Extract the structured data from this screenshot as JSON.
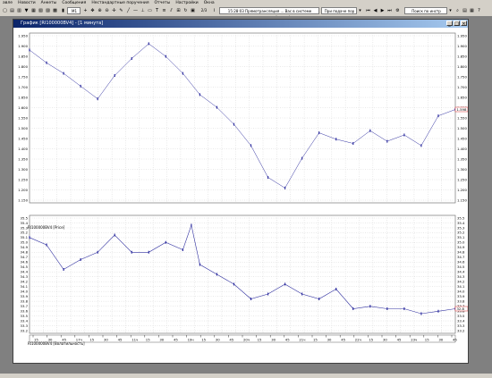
{
  "menu": [
    "авле",
    "Новости",
    "Анкеты",
    "Сообщения",
    "Нестандартные поручения",
    "Отчеты",
    "Настройки",
    "Окна"
  ],
  "toolbar": {
    "quantity": "М1",
    "zoom": "2/3",
    "news_ticker": "15:28:03  Прямотрансляция ... Вас в системе интернет-трейдинга!",
    "news_dropdown": "При подаче пор",
    "search_placeholder": "Поиск по инстр"
  },
  "window": {
    "title": "График [RI100000BV4] - [1 минута]",
    "price_label": "RI100000BV4 [Price]",
    "vol_label": "RI100000BV4 [Волатильность]",
    "price_marker": "1.598",
    "vol_marker": "32.8"
  },
  "colors": {
    "series": "#3030a0",
    "titlebar": "#0a246a",
    "grid": "#c8c8c8"
  },
  "chart_data": [
    {
      "type": "line",
      "title": "",
      "ylabel": "",
      "ylim": [
        1150,
        1950
      ],
      "y_ticks": [
        "1.950",
        "1.900",
        "1.850",
        "1.800",
        "1.750",
        "1.700",
        "1.650",
        "1.600",
        "1.550",
        "1.500",
        "1.450",
        "1.400",
        "1.350",
        "1.300",
        "1.250",
        "1.200",
        "1.150"
      ],
      "x": [
        0,
        4,
        8,
        12,
        16,
        20,
        24,
        28,
        32,
        36,
        40,
        44,
        48,
        52,
        56,
        60,
        64,
        68,
        72,
        76,
        80,
        84,
        88,
        92,
        96,
        100
      ],
      "series": [
        {
          "name": "",
          "values": [
            1870,
            1810,
            1760,
            1700,
            1640,
            1750,
            1830,
            1900,
            1840,
            1760,
            1660,
            1600,
            1520,
            1420,
            1270,
            1220,
            1360,
            1480,
            1450,
            1430,
            1490,
            1440,
            1470,
            1420,
            1560,
            1590
          ]
        }
      ]
    },
    {
      "type": "line",
      "title": "",
      "ylabel": "",
      "ylim": [
        33.1,
        35.5
      ],
      "y_ticks": [
        "35.5",
        "35.4",
        "35.3",
        "35.2",
        "35.1",
        "35.0",
        "34.9",
        "34.8",
        "34.7",
        "34.6",
        "34.5",
        "34.4",
        "34.3",
        "34.2",
        "34.1",
        "34.0",
        "33.9",
        "33.8",
        "33.7",
        "33.6",
        "33.5",
        "33.4",
        "33.3",
        "33.2"
      ],
      "x": [
        0,
        4,
        8,
        12,
        16,
        20,
        24,
        28,
        32,
        36,
        38,
        40,
        44,
        48,
        52,
        56,
        60,
        64,
        68,
        72,
        76,
        80,
        84,
        88,
        92,
        96,
        100
      ],
      "series": [
        {
          "name": "",
          "values": [
            35.05,
            34.9,
            34.4,
            34.6,
            34.75,
            35.1,
            34.75,
            34.75,
            34.95,
            34.8,
            35.3,
            34.5,
            34.3,
            34.1,
            33.8,
            33.9,
            34.1,
            33.9,
            33.8,
            34.0,
            33.6,
            33.65,
            33.6,
            33.6,
            33.5,
            33.55,
            33.6
          ]
        }
      ]
    }
  ],
  "time_axis": [
    "15",
    "30",
    "45",
    "17ч",
    "15",
    "30",
    "45",
    "11ч",
    "15",
    "30",
    "45",
    "19ч",
    "15",
    "30",
    "45",
    "20ч",
    "15",
    "30",
    "45",
    "21ч",
    "15",
    "30",
    "45",
    "22ч",
    "15",
    "30",
    "45",
    "23ч",
    "15",
    "30",
    "45"
  ]
}
